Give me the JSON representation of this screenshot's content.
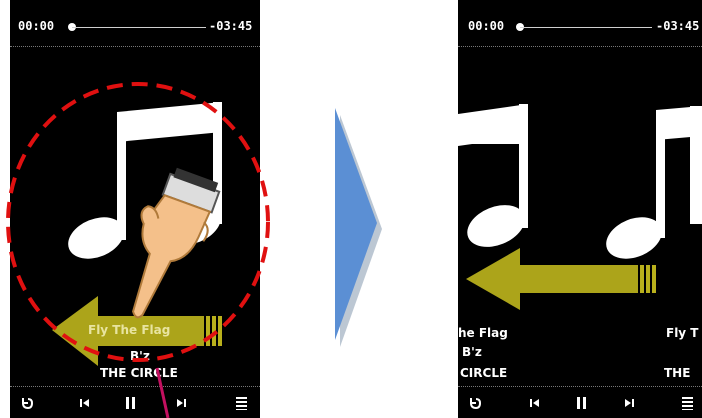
{
  "player": {
    "time_elapsed": "00:00",
    "time_remaining": "-03:45",
    "title": "Fly The Flag",
    "artist": "B'z",
    "album": "THE CIRCLE"
  },
  "right_player": {
    "time_elapsed": "00:00",
    "time_remaining": "-03:45",
    "title_partial": "he Flag",
    "artist_partial": "B'z",
    "album_partial": "CIRCLE",
    "next_title_partial": "Fly T",
    "next_album_partial": "THE"
  },
  "colors": {
    "arrow_fill": "#b9b01c",
    "flow_arrow": "#5b8fd4",
    "dashed_circle": "#e01010",
    "hand": "#f4c08a"
  },
  "icons": [
    "back-icon",
    "previous-track-icon",
    "pause-icon",
    "next-track-icon",
    "menu-icon",
    "music-note-icon",
    "swipe-hand-icon",
    "swipe-left-arrow-icon"
  ]
}
